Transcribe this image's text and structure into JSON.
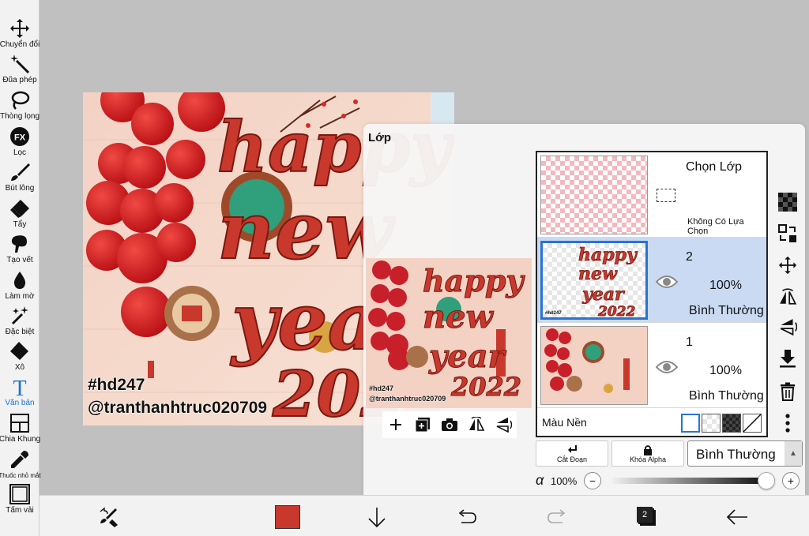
{
  "colors": {
    "accent": "#2a72d6",
    "primary_color": "#c8382c",
    "red": "#c8382c"
  },
  "toolbar": [
    {
      "label": "Chuyển đổi",
      "icon": "move-arrows-icon"
    },
    {
      "label": "Đũa phép",
      "icon": "magic-wand-icon"
    },
    {
      "label": "Thòng lọng",
      "icon": "lasso-icon"
    },
    {
      "label": "Lọc",
      "icon": "fx-filter-icon"
    },
    {
      "label": "Bút lông",
      "icon": "brush-icon"
    },
    {
      "label": "Tẩy",
      "icon": "eraser-icon"
    },
    {
      "label": "Tạo vết",
      "icon": "smudge-icon"
    },
    {
      "label": "Làm mờ",
      "icon": "blur-drop-icon"
    },
    {
      "label": "Đặc biệt",
      "icon": "special-sparkle-icon"
    },
    {
      "label": "Xô",
      "icon": "bucket-icon"
    },
    {
      "label": "Văn bản",
      "icon": "text-t-icon"
    },
    {
      "label": "Chia Khung",
      "icon": "frame-divider-icon"
    },
    {
      "label": "Thuốc nhỏ mắt",
      "icon": "eyedropper-icon"
    },
    {
      "label": "Tấm vải",
      "icon": "canvas-icon"
    }
  ],
  "artwork": {
    "line1": "happy",
    "line2": "new",
    "line3": "year",
    "line4": "2022",
    "hashtag": "#hd247",
    "handle": "@tranthanhtruc020709"
  },
  "panel": {
    "title": "Lớp",
    "selection_layer": {
      "title": "Chọn Lớp",
      "subtitle": "Không Có Lựa Chọn"
    },
    "layers": [
      {
        "number": "2",
        "opacity": "100%",
        "blend": "Bình Thường"
      },
      {
        "number": "1",
        "opacity": "100%",
        "blend": "Bình Thường"
      }
    ],
    "background_label": "Màu Nền",
    "cut_label": "Cắt Đoạn",
    "lock_label": "Khóa Alpha",
    "blend_mode": "Bình Thường",
    "alpha_symbol": "α",
    "alpha_value": "100%",
    "alpha_level": 1.0
  },
  "bottombar": {
    "layer_count": "2"
  }
}
